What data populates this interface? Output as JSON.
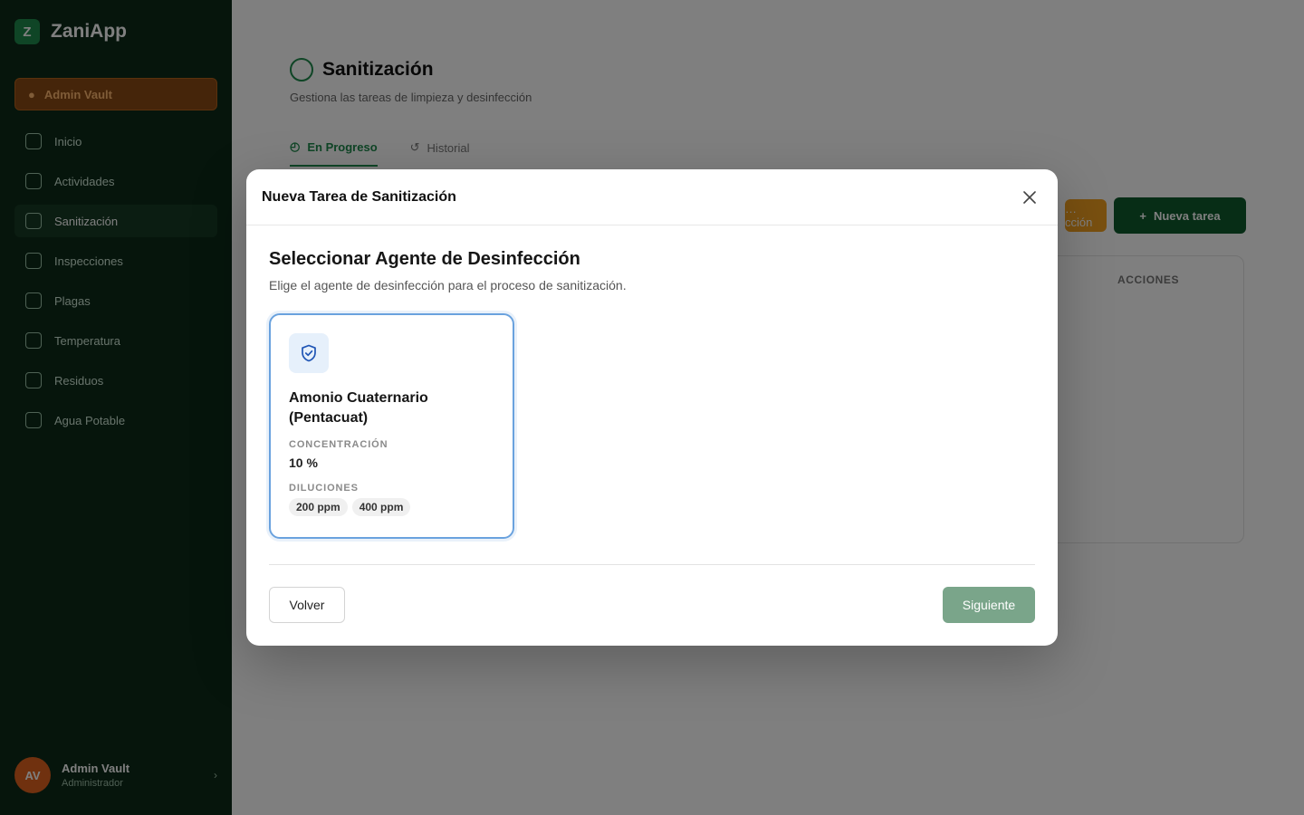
{
  "app": {
    "brand_initial": "Z",
    "brand_name": "ZaniApp",
    "admin_pill": "Admin Vault",
    "nav": [
      {
        "label": "Inicio",
        "active": false
      },
      {
        "label": "Actividades",
        "active": false
      },
      {
        "label": "Sanitización",
        "active": true
      },
      {
        "label": "Inspecciones",
        "active": false
      },
      {
        "label": "Plagas",
        "active": false
      },
      {
        "label": "Temperatura",
        "active": false
      },
      {
        "label": "Residuos",
        "active": false
      },
      {
        "label": "Agua Potable",
        "active": false
      }
    ],
    "user": {
      "initials": "AV",
      "name": "Admin Vault",
      "role": "Administrador"
    }
  },
  "page": {
    "title": "Sanitización",
    "subtitle": "Gestiona las tareas de limpieza y desinfección",
    "tabs": [
      {
        "label": "En Progreso",
        "active": true
      },
      {
        "label": "Historial",
        "active": false
      }
    ],
    "orange_button": "…cción",
    "new_task_button": "Nueva tarea",
    "column_actions": "ACCIONES"
  },
  "modal": {
    "title": "Nueva Tarea de Sanitización",
    "step_title": "Seleccionar Agente de Desinfección",
    "step_subtitle": "Elige el agente de desinfección para el proceso de sanitización.",
    "agent": {
      "icon": "shield-check-icon",
      "name": "Amonio Cuaternario (Pentacuat)",
      "concentration_label": "CONCENTRACIÓN",
      "concentration_value": "10 %",
      "dilutions_label": "DILUCIONES",
      "dilutions": [
        "200 ppm",
        "400 ppm"
      ],
      "selected": true
    },
    "back_label": "Volver",
    "next_label": "Siguiente"
  },
  "colors": {
    "sidebar_bg": "#0c2a18",
    "brand_green": "#1f8a4c",
    "selected_border": "#6aa2de",
    "next_button": "#7aa58a"
  }
}
